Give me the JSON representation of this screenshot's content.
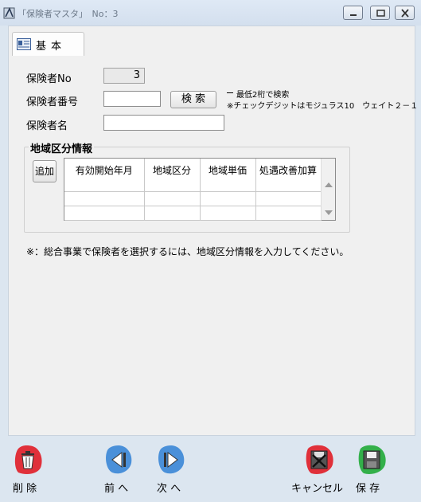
{
  "window": {
    "title": "「保険者マスタ」　No：3",
    "controls": [
      "minimize-icon",
      "restore-icon",
      "close-icon"
    ]
  },
  "tabs": [
    {
      "label": "基本",
      "icon": "card-icon",
      "active": true
    }
  ],
  "form": {
    "no_label": "保険者No",
    "no_value": "3",
    "number_label": "保険者番号",
    "number_value": "",
    "search_button": "検 索",
    "note_line1": "最低2桁で検索",
    "note_line2": "※チェックデジットはモジュラス10　ウェイト２－１",
    "name_label": "保険者名",
    "name_value": ""
  },
  "region": {
    "group_title": "地域区分情報",
    "add_button": "追加",
    "columns": [
      "有効開始年月",
      "地域区分",
      "地域単価",
      "処遇改善加算"
    ],
    "rows": [
      [
        "",
        "",
        "",
        ""
      ],
      [
        "",
        "",
        "",
        ""
      ]
    ]
  },
  "footer_note": "※：総合事業で保険者を選択するには、地域区分情報を入力してください。",
  "toolbar": {
    "delete_label": "削 除",
    "prev_label": "前 へ",
    "next_label": "次 へ",
    "cancel_label": "キャンセル",
    "save_label": "保 存"
  },
  "colors": {
    "window_bg": "#dce6f0",
    "client_bg": "#f0f0f0",
    "delete_accent": "#e0303a",
    "nav_accent": "#4a90d9",
    "cancel_accent": "#e0303a",
    "save_accent": "#33b04a"
  }
}
